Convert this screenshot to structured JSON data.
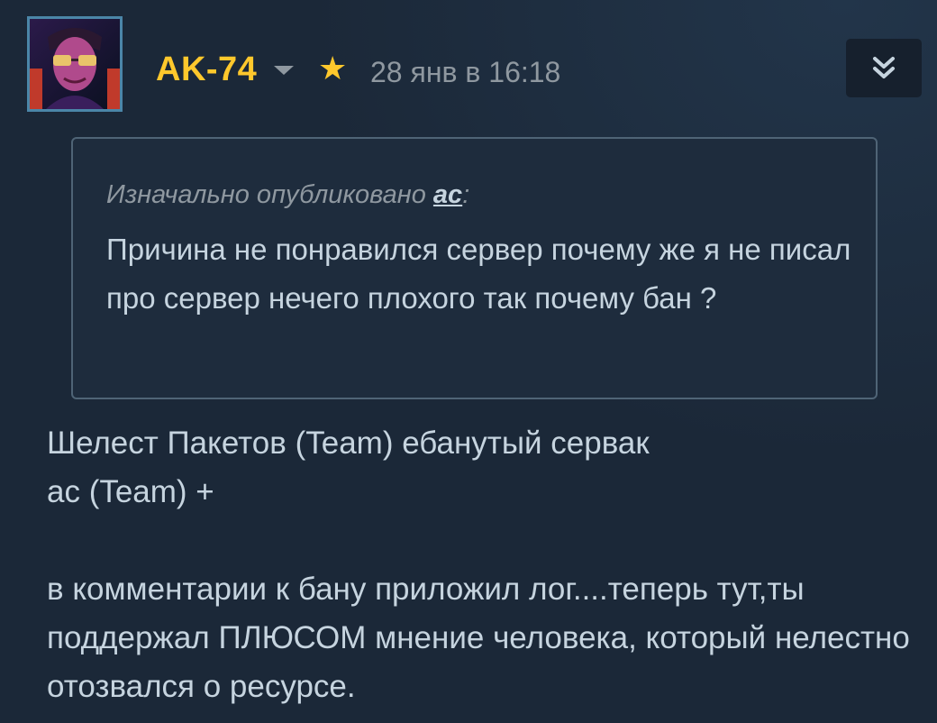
{
  "post": {
    "author": "AK-74",
    "timestamp": "28 янв в 16:18"
  },
  "icons": {
    "avatar": "avatar-image",
    "dropdown": "caret-down-icon",
    "star": "star-icon",
    "expand": "double-chevron-down-icon"
  },
  "colors": {
    "background": "#1b2838",
    "author": "#ffc82c",
    "text": "#c6d4df",
    "muted": "#8f98a0",
    "quote_border": "#4f6476"
  },
  "quote": {
    "prefix": "Изначально опубликовано ",
    "author": "ac",
    "suffix": ":",
    "text": "Причина не понравился сервер почему же я не писал про сервер нечего плохого так почему бан ?"
  },
  "body": {
    "line1": "Шелест Пакетов (Team) ебанутый сервак",
    "line2": "ac (Team) +",
    "line3": "в комментарии к бану приложил лог....теперь тут,ты поддержал ПЛЮСОМ мнение человека, который нелестно отозвался о ресурсе."
  }
}
